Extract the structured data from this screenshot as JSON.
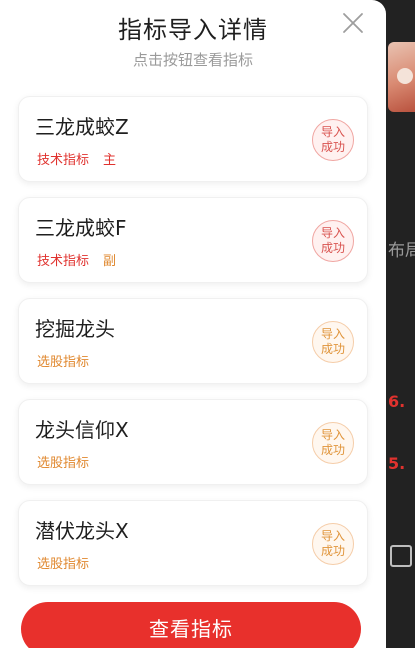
{
  "header": {
    "title": "指标导入详情",
    "subtitle": "点击按钮查看指标"
  },
  "items": [
    {
      "name": "三龙成蛟Z",
      "category": "技术指标",
      "role": "主",
      "status_line1": "导入",
      "status_line2": "成功",
      "tone": "red"
    },
    {
      "name": "三龙成蛟F",
      "category": "技术指标",
      "role": "副",
      "status_line1": "导入",
      "status_line2": "成功",
      "tone": "red"
    },
    {
      "name": "挖掘龙头",
      "category": "选股指标",
      "role": "",
      "status_line1": "导入",
      "status_line2": "成功",
      "tone": "orange"
    },
    {
      "name": "龙头信仰X",
      "category": "选股指标",
      "role": "",
      "status_line1": "导入",
      "status_line2": "成功",
      "tone": "orange"
    },
    {
      "name": "潜伏龙头X",
      "category": "选股指标",
      "role": "",
      "status_line1": "导入",
      "status_line2": "成功",
      "tone": "orange"
    }
  ],
  "cta": {
    "label": "查看指标"
  },
  "background": {
    "fragment1": "布局",
    "fragment2": "6.",
    "fragment3": "5."
  },
  "colors": {
    "accent_red": "#e8302c",
    "tag_red": "#e0322e",
    "tag_orange": "#e0882f"
  }
}
